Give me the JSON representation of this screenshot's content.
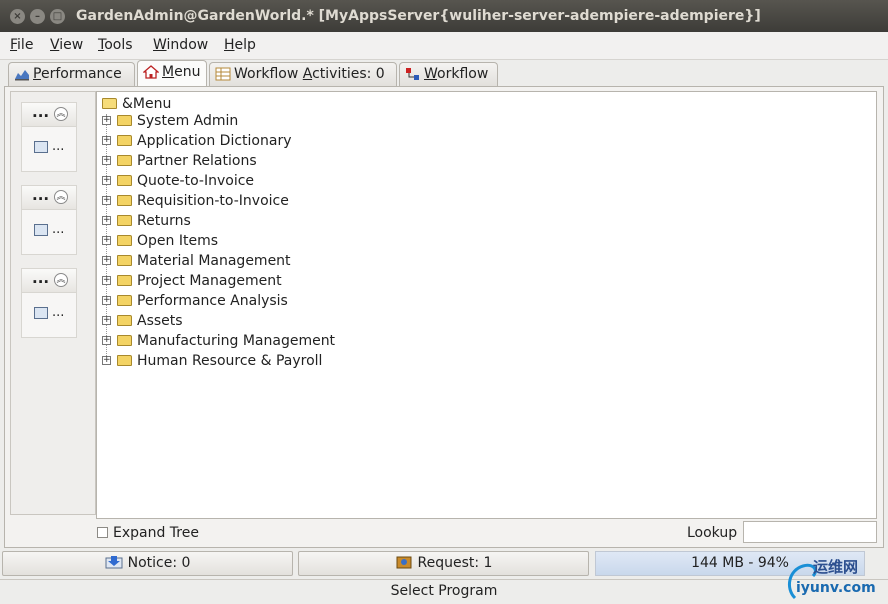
{
  "window": {
    "title": "GardenAdmin@GardenWorld.* [MyAppsServer{wuliher-server-adempiere-adempiere}]",
    "close_glyph": "×",
    "minimize_glyph": "–",
    "maximize_glyph": "□"
  },
  "menubar": {
    "items": [
      {
        "label": "File",
        "mnemonic": "F",
        "rest": "ile"
      },
      {
        "label": "View",
        "mnemonic": "V",
        "rest": "iew"
      },
      {
        "label": "Tools",
        "mnemonic": "T",
        "rest": "ools"
      },
      {
        "label": "Window",
        "mnemonic": "W",
        "rest": "indow"
      },
      {
        "label": "Help",
        "mnemonic": "H",
        "rest": "elp"
      }
    ]
  },
  "tabs": [
    {
      "label": "Performance",
      "pre": "",
      "mn": "P",
      "post": "erformance",
      "icon": "chart-icon",
      "active": false
    },
    {
      "label": "Menu",
      "pre": "",
      "mn": "M",
      "post": "enu",
      "icon": "home-icon",
      "active": true
    },
    {
      "label": "Workflow Activities: 0",
      "pre": "Workflow ",
      "mn": "A",
      "post": "ctivities: 0",
      "icon": "table-icon",
      "active": false
    },
    {
      "label": "Workflow",
      "pre": "",
      "mn": "W",
      "post": "orkflow",
      "icon": "workflow-icon",
      "active": false
    }
  ],
  "left_panel": {
    "groups": [
      {
        "header": "...",
        "item": "..."
      },
      {
        "header": "...",
        "item": "..."
      },
      {
        "header": "...",
        "item": "..."
      }
    ]
  },
  "tree": {
    "root": "&Menu",
    "nodes": [
      "System Admin",
      "Application Dictionary",
      "Partner Relations",
      "Quote-to-Invoice",
      "Requisition-to-Invoice",
      "Returns",
      "Open Items",
      "Material Management",
      "Project Management",
      "Performance Analysis",
      "Assets",
      "Manufacturing Management",
      "Human Resource & Payroll"
    ],
    "expander_glyph": "+"
  },
  "bottom_controls": {
    "expand_tree_label": "Expand Tree",
    "expand_tree_checked": false,
    "lookup_label": "Lookup",
    "lookup_value": ""
  },
  "status": {
    "notice_label": "Notice: 0",
    "request_label": "Request: 1",
    "memory_label": "144 MB - 94%"
  },
  "footer": {
    "status_text": "Select Program"
  },
  "watermark": {
    "line1": "运维网",
    "line2": "iyunv.com"
  },
  "colors": {
    "titlebar": "#3d3c38",
    "folder": "#f3d364",
    "memory_bar": "#c9d8ec"
  }
}
